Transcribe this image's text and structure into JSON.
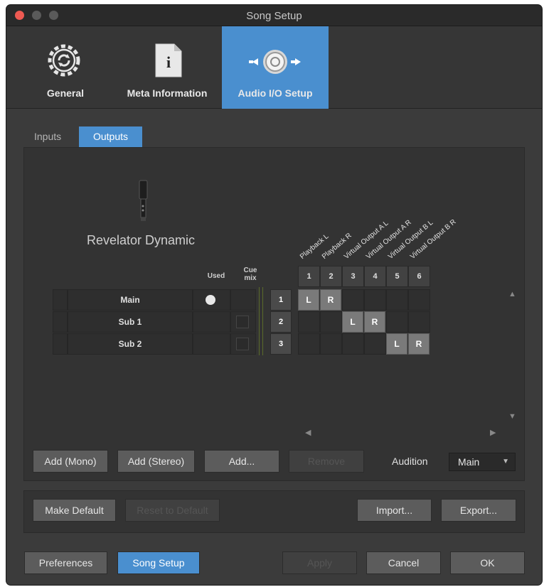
{
  "window": {
    "title": "Song Setup"
  },
  "categories": [
    {
      "label": "General",
      "icon": "gear-refresh-icon"
    },
    {
      "label": "Meta Information",
      "icon": "info-document-icon"
    },
    {
      "label": "Audio I/O Setup",
      "icon": "audio-io-icon"
    }
  ],
  "tabs": {
    "inputs": "Inputs",
    "outputs": "Outputs"
  },
  "device": {
    "name": "Revelator Dynamic",
    "icon": "microphone-icon"
  },
  "matrix": {
    "used_header": "Used",
    "cue_mix_header": "Cue\nmix",
    "channel_labels": [
      "Playback L",
      "Playback R",
      "Virtual Output A L",
      "Virtual Output A R",
      "Virtual Output B L",
      "Virtual Output B R"
    ],
    "column_numbers": [
      "1",
      "2",
      "3",
      "4",
      "5",
      "6"
    ],
    "rows": [
      {
        "name": "Main",
        "number": "1",
        "used": true,
        "assign": [
          "L",
          "R",
          "",
          "",
          "",
          ""
        ]
      },
      {
        "name": "Sub 1",
        "number": "2",
        "used": false,
        "assign": [
          "",
          "",
          "L",
          "R",
          "",
          ""
        ]
      },
      {
        "name": "Sub 2",
        "number": "3",
        "used": false,
        "assign": [
          "",
          "",
          "",
          "",
          "L",
          "R"
        ]
      }
    ]
  },
  "buttons": {
    "add_mono": "Add (Mono)",
    "add_stereo": "Add (Stereo)",
    "add": "Add...",
    "remove": "Remove",
    "audition_label": "Audition",
    "audition_value": "Main",
    "make_default": "Make Default",
    "reset_default": "Reset to Default",
    "import": "Import...",
    "export": "Export...",
    "preferences": "Preferences",
    "song_setup": "Song Setup",
    "apply": "Apply",
    "cancel": "Cancel",
    "ok": "OK"
  },
  "colors": {
    "accent": "#4a8fcf",
    "close": "#ee5a52"
  }
}
